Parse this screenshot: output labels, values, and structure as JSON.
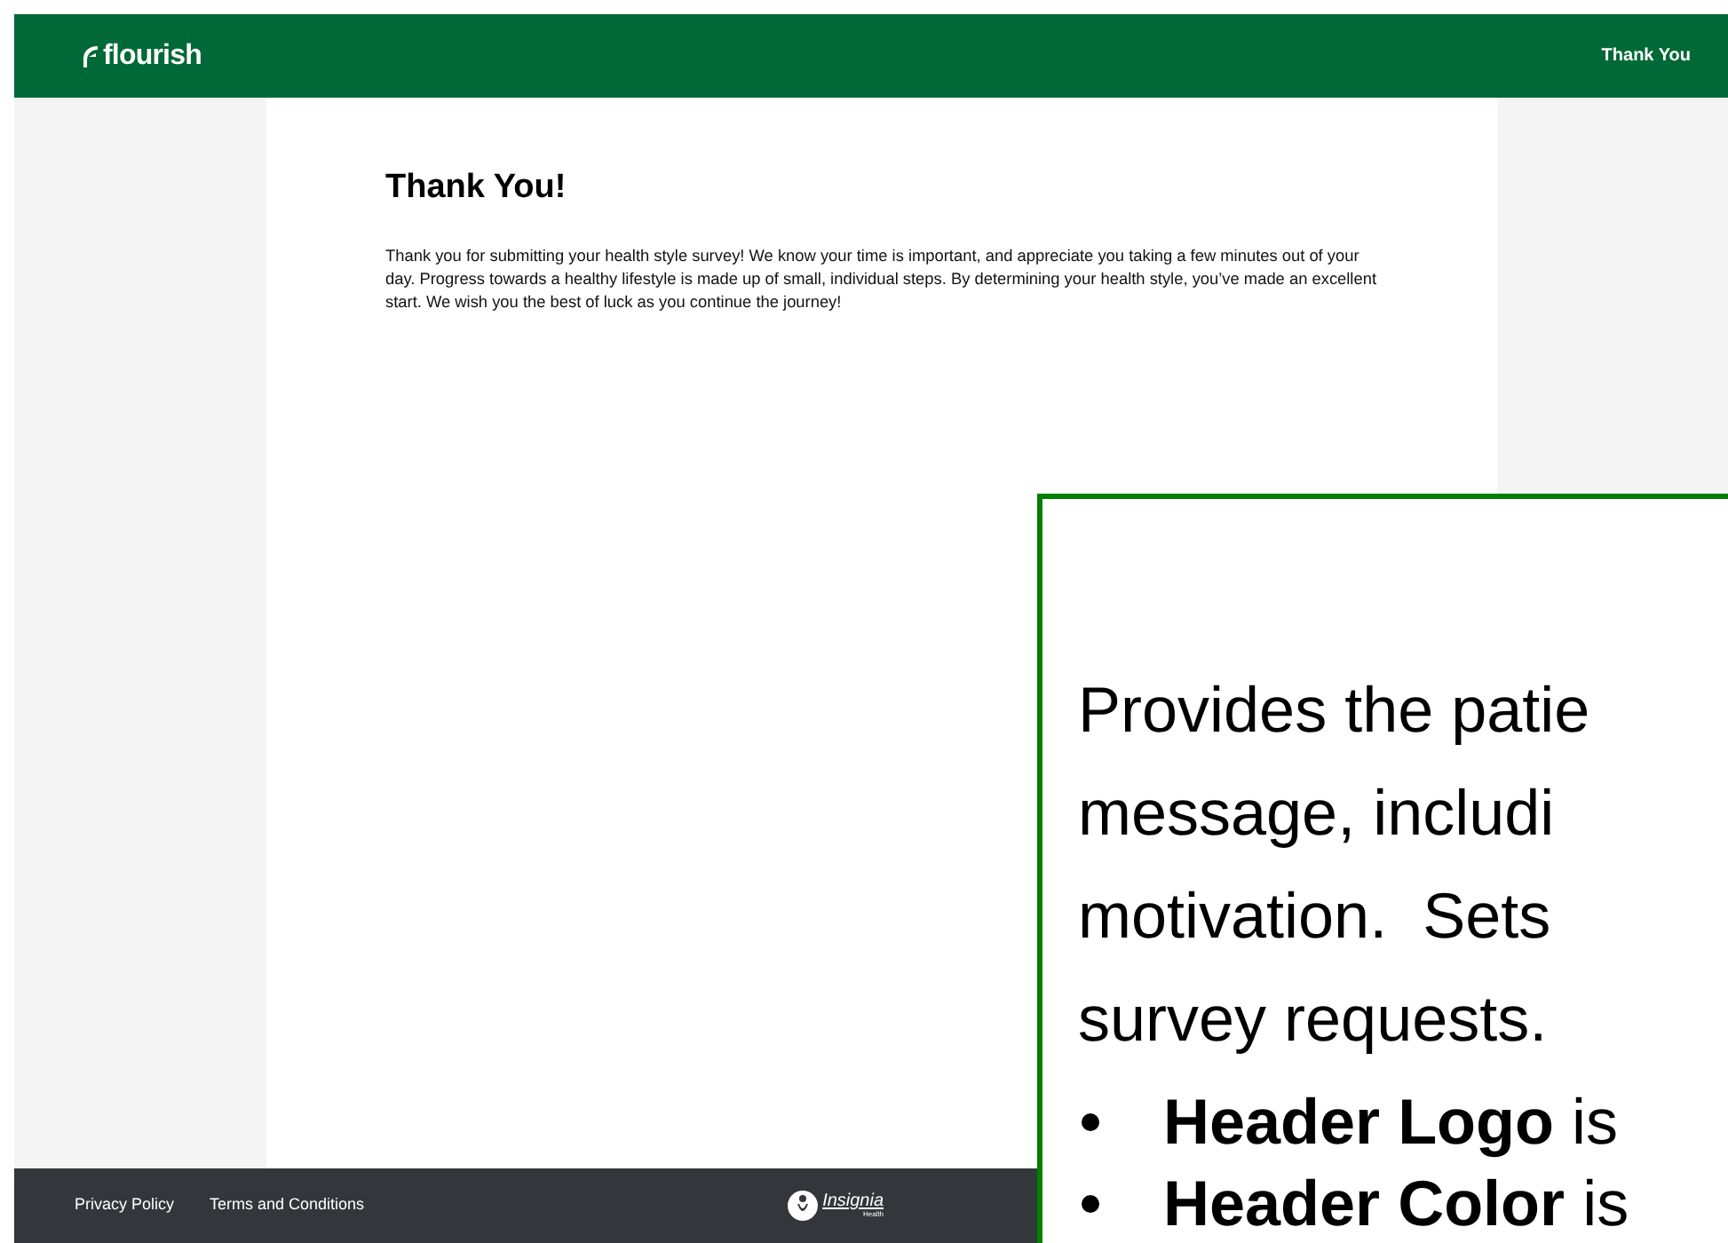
{
  "header": {
    "logo": "flourish",
    "nav_link": "Thank You"
  },
  "content": {
    "title": "Thank You!",
    "message": "Thank you for submitting your health style survey! We know your time is important, and appreciate you taking a few minutes out of your day. Progress towards a healthy lifestyle is  made up of small, individual steps. By determining your health style, you’ve made an excellent start. We wish you the best of luck as you continue the journey!"
  },
  "footer": {
    "links": [
      "Privacy Policy",
      "Terms and Conditions"
    ],
    "brand": "Insignia",
    "brand_sub": "Health"
  },
  "callout": {
    "lines": [
      "Provides the patie",
      "message, includi",
      "motivation.  Sets",
      "survey requests."
    ],
    "bullets": [
      "**Header Logo** is",
      "**Header Color** is"
    ]
  }
}
